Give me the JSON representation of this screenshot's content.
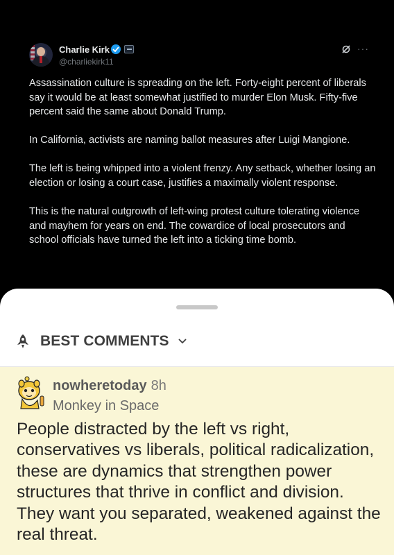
{
  "tweet": {
    "author_name": "Charlie Kirk",
    "author_handle": "@charliekirk11",
    "icons": [
      "verified-icon",
      "affiliation-badge-icon",
      "grok-icon",
      "more-icon"
    ],
    "paragraphs": [
      "Assassination culture is spreading on the left. Forty-eight percent of liberals say it would be at least somewhat justified to murder Elon Musk. Fifty-five percent said the same about Donald Trump.",
      "In California, activists are naming ballot measures after Luigi Mangione.",
      "The left is being whipped into a violent frenzy. Any setback, whether losing an election or losing a court case, justifies a maximally violent response.",
      "This is the natural outgrowth of left-wing protest culture tolerating violence and mayhem for years on end. The cowardice of local prosecutors and school officials have turned the left into a ticking time bomb."
    ]
  },
  "sheet": {
    "section_title": "BEST COMMENTS",
    "icons": [
      "rocket-icon",
      "chevron-down-icon"
    ]
  },
  "comment": {
    "username": "nowheretoday",
    "time": "8h",
    "flair": "Monkey in Space",
    "text": "People distracted by the left vs right, conservatives vs liberals, political radicalization, these are dynamics that strengthen power structures that thrive in conflict and division. They want you separated, weakened against the real threat."
  },
  "colors": {
    "tweet_bg": "#000000",
    "verified": "#1d9bf0",
    "comment_bg": "#faf6d6"
  }
}
